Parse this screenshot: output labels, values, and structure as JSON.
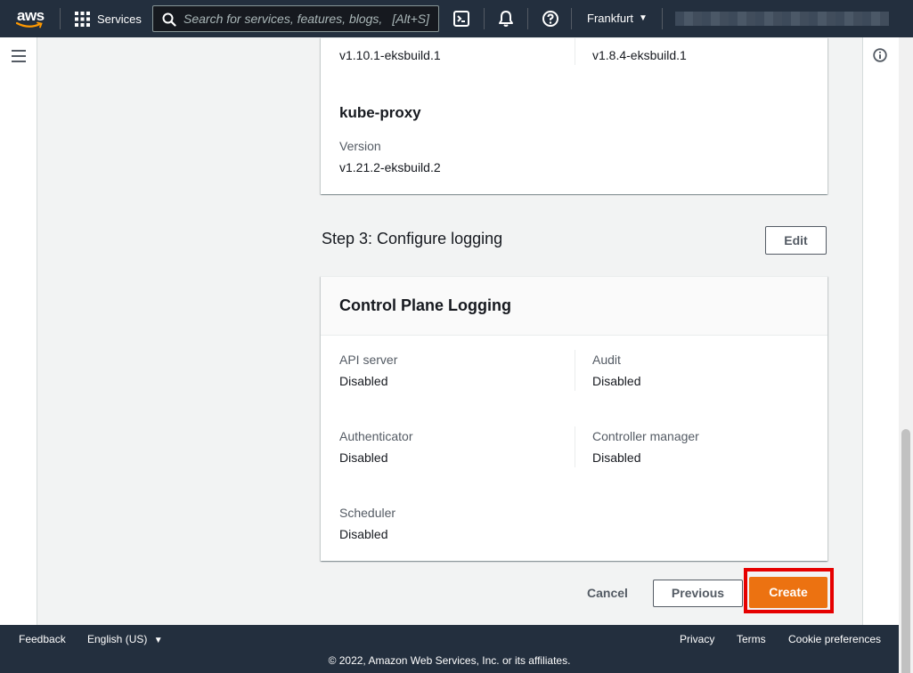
{
  "topnav": {
    "logo_text": "aws",
    "services_label": "Services",
    "search_placeholder": "Search for services, features, blogs,",
    "search_shortcut": "[Alt+S]",
    "region_label": "Frankfurt",
    "account_label": "[redacted account]"
  },
  "addons_card": {
    "versions": [
      "v1.10.1-eksbuild.1",
      "v1.8.4-eksbuild.1"
    ],
    "kube_proxy": {
      "title": "kube-proxy",
      "version_label": "Version",
      "version_value": "v1.21.2-eksbuild.2"
    }
  },
  "step3": {
    "title": "Step 3: Configure logging",
    "edit_label": "Edit"
  },
  "logging_card": {
    "title": "Control Plane Logging",
    "items": [
      {
        "label": "API server",
        "value": "Disabled"
      },
      {
        "label": "Audit",
        "value": "Disabled"
      },
      {
        "label": "Authenticator",
        "value": "Disabled"
      },
      {
        "label": "Controller manager",
        "value": "Disabled"
      },
      {
        "label": "Scheduler",
        "value": "Disabled"
      }
    ]
  },
  "actions": {
    "cancel_label": "Cancel",
    "previous_label": "Previous",
    "create_label": "Create"
  },
  "footer": {
    "feedback": "Feedback",
    "language": "English (US)",
    "privacy": "Privacy",
    "terms": "Terms",
    "cookie": "Cookie preferences",
    "copyright": "© 2022, Amazon Web Services, Inc. or its affiliates."
  },
  "colors": {
    "nav_bg": "#232f3e",
    "primary_button": "#ec7211",
    "highlight_outline": "#e60000"
  },
  "icons": [
    "aws-logo",
    "grid-icon",
    "search-icon",
    "cloudshell-icon",
    "bell-icon",
    "help-icon",
    "caret-down-icon",
    "menu-icon",
    "info-icon"
  ]
}
